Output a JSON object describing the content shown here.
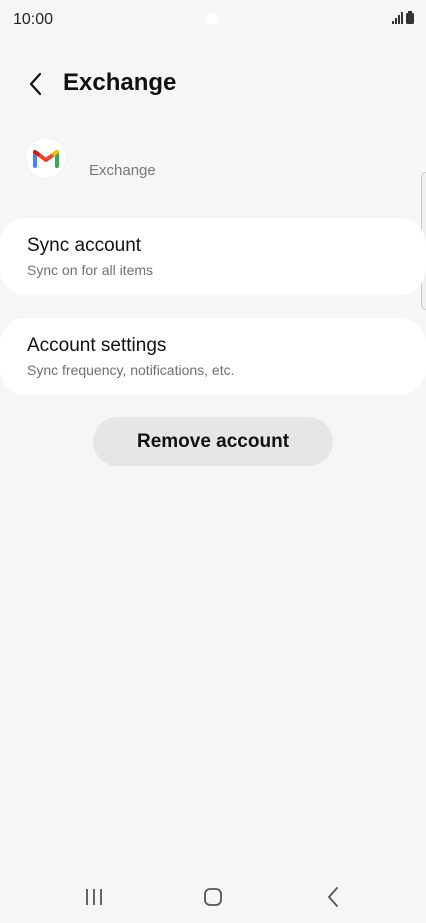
{
  "status_bar": {
    "time": "10:00"
  },
  "header": {
    "title": "Exchange",
    "back_icon": "chevron-left-icon"
  },
  "account": {
    "icon": "gmail-icon",
    "name": "Exchange"
  },
  "items": [
    {
      "title": "Sync account",
      "subtitle": "Sync on for all items"
    },
    {
      "title": "Account settings",
      "subtitle": "Sync frequency, notifications, etc."
    }
  ],
  "remove_button": {
    "label": "Remove account"
  },
  "nav_bar": {
    "recent_icon": "recent-apps-icon",
    "home_icon": "home-icon",
    "back_icon": "back-icon"
  },
  "colors": {
    "background": "#f6f6f8",
    "card": "#ffffff",
    "button": "#e6e6e9",
    "gmail_red": "#ea4335",
    "gmail_blue": "#4285f4",
    "gmail_green": "#34a853",
    "gmail_yellow": "#fbbc04"
  }
}
